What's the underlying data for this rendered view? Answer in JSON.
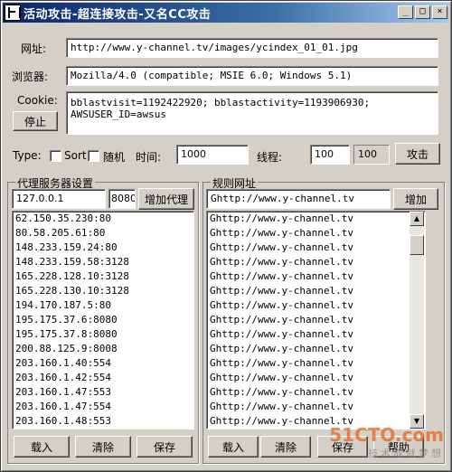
{
  "window": {
    "title": "活动攻击-超连接攻击-又名CC攻击",
    "controls": [
      "_",
      "□",
      "×"
    ]
  },
  "url": {
    "label": "网址:",
    "value": "http://www.y-channel.tv/images/ycindex_01_01.jpg"
  },
  "browser": {
    "label": "浏览器:",
    "value": "Mozilla/4.0 (compatible; MSIE 6.0; Windows 5.1)"
  },
  "cookie": {
    "label": "Cookie:",
    "value": "bblastvisit=1192422920; bblastactivity=1193906930; AWSUSER_ID=awsus",
    "stop_label": "停止"
  },
  "options": {
    "type_label": "Type:",
    "sort_label": "Sort",
    "random_label": "随机",
    "time_label": "时间:",
    "time_value": "1000",
    "threads_label": "线程:",
    "threads_value": "100",
    "threads_display": "100",
    "attack_label": "攻击"
  },
  "proxy": {
    "title": "代理服务器设置",
    "ip_value": "127.0.0.1",
    "port_value": "8080",
    "add_label": "增加代理",
    "items": [
      "62.150.35.230:80",
      "80.58.205.61:80",
      "148.233.159.24:80",
      "148.233.159.58:3128",
      "165.228.128.10:3128",
      "165.228.130.10:3128",
      "194.170.187.5:80",
      "195.175.37.6:8080",
      "195.175.37.8:8080",
      "200.88.125.9:8008",
      "203.160.1.40:554",
      "203.160.1.42:554",
      "203.160.1.47:553",
      "203.160.1.47:554",
      "203.160.1.48:553"
    ],
    "load_label": "载入",
    "clear_label": "清除",
    "save_label": "保存"
  },
  "rules": {
    "title": "规则网址",
    "input_value": "Ghttp://www.y-channel.tv",
    "add_label": "增加",
    "items": [
      "Ghttp://www.y-channel.tv",
      "Ghttp://www.y-channel.tv",
      "Ghttp://www.y-channel.tv",
      "Ghttp://www.y-channel.tv",
      "Ghttp://www.y-channel.tv",
      "Ghttp://www.y-channel.tv",
      "Ghttp://www.y-channel.tv",
      "Ghttp://www.y-channel.tv",
      "Ghttp://www.y-channel.tv",
      "Ghttp://www.y-channel.tv",
      "Ghttp://www.y-channel.tv",
      "Ghttp://www.y-channel.tv",
      "Ghttp://www.y-channel.tv",
      "Ghttp://www.y-channel.tv",
      "Ghttp://www.y-channel.tv"
    ],
    "load_label": "载入",
    "clear_label": "清除",
    "save_label": "保存",
    "help_label": "帮助"
  },
  "watermark": {
    "logo": "51CTO.com",
    "sub": "技术成就梦想"
  }
}
